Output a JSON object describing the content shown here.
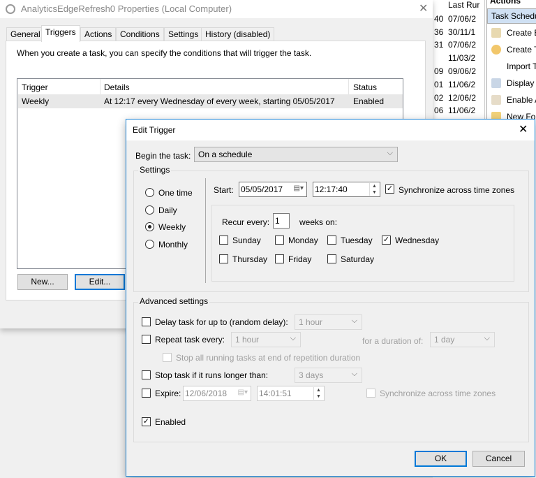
{
  "background": {
    "last_run_header": "Last Rur",
    "list_rows": [
      {
        "a": "40",
        "b": "07/06/2"
      },
      {
        "a": "36",
        "b": "30/11/1"
      },
      {
        "a": "31",
        "b": "07/06/2"
      },
      {
        "a": "",
        "b": "11/03/2"
      },
      {
        "a": "09",
        "b": "09/06/2"
      },
      {
        "a": "01",
        "b": "11/06/2"
      },
      {
        "a": "02",
        "b": "12/06/2"
      },
      {
        "a": "06",
        "b": "11/06/2"
      }
    ],
    "actions_header": "Actions",
    "actions": [
      "Task Schedu",
      "Create B",
      "Create T",
      "Import T",
      "Display A",
      "Enable A",
      "New Fol"
    ]
  },
  "properties": {
    "title": "AnalyticsEdgeRefresh0 Properties (Local Computer)",
    "tabs": [
      "General",
      "Triggers",
      "Actions",
      "Conditions",
      "Settings",
      "History (disabled)"
    ],
    "description": "When you create a task, you can specify the conditions that will trigger the task.",
    "columns": [
      "Trigger",
      "Details",
      "Status"
    ],
    "rows": [
      {
        "trigger": "Weekly",
        "details": "At 12:17 every Wednesday of every week, starting 05/05/2017",
        "status": "Enabled"
      }
    ],
    "new_label": "New...",
    "edit_label": "Edit..."
  },
  "dialog": {
    "title": "Edit Trigger",
    "begin_label": "Begin the task:",
    "begin_value": "On a schedule",
    "settings_label": "Settings",
    "schedule_options": [
      "One time",
      "Daily",
      "Weekly",
      "Monthly"
    ],
    "start_label": "Start:",
    "start_date": "05/05/2017",
    "start_time": "12:17:40",
    "sync_label": "Synchronize across time zones",
    "recur_label": "Recur every:",
    "recur_value": "1",
    "weeks_on": "weeks on:",
    "days": [
      "Sunday",
      "Monday",
      "Tuesday",
      "Wednesday",
      "Thursday",
      "Friday",
      "Saturday"
    ],
    "advanced_label": "Advanced settings",
    "delay_label": "Delay task for up to (random delay):",
    "delay_value": "1 hour",
    "repeat_label": "Repeat task every:",
    "repeat_value": "1 hour",
    "duration_label": "for a duration of:",
    "duration_value": "1 day",
    "stop_all_label": "Stop all running tasks at end of repetition duration",
    "stop_longer_label": "Stop task if it runs longer than:",
    "stop_longer_value": "3 days",
    "expire_label": "Expire:",
    "expire_date": "12/06/2018",
    "expire_time": "14:01:51",
    "expire_sync_label": "Synchronize across time zones",
    "enabled_label": "Enabled",
    "ok_label": "OK",
    "cancel_label": "Cancel"
  }
}
